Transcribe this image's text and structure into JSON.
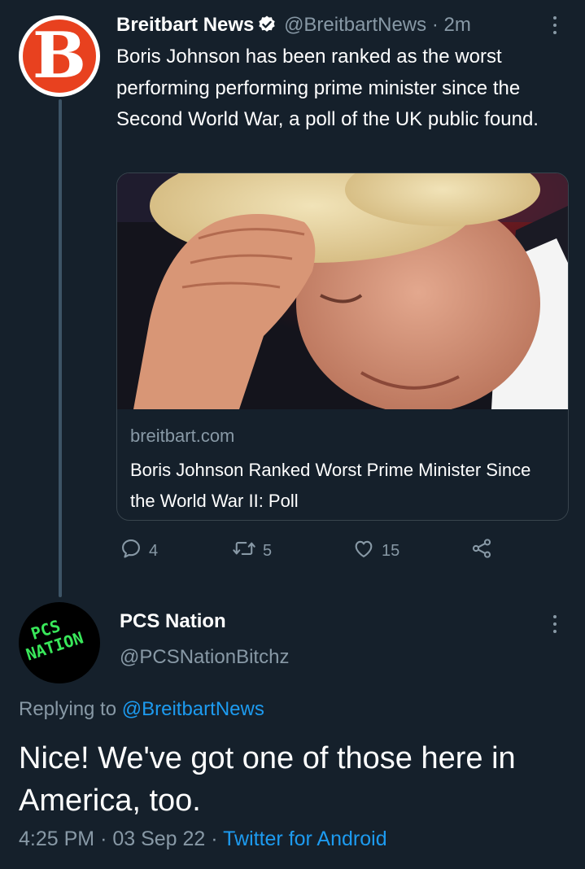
{
  "tweet": {
    "author_name": "Breitbart News",
    "handle": "@BreitbartNews",
    "separator": "·",
    "time": "2m",
    "avatar_letter": "B",
    "text": "Boris Johnson has been ranked as the worst performing performing prime minister since the Second World War, a poll of the UK public found.",
    "card": {
      "domain": "breitbart.com",
      "title": "Boris Johnson Ranked Worst Prime Minister Since the World War II: Poll"
    },
    "actions": {
      "replies": "4",
      "retweets": "5",
      "likes": "15"
    }
  },
  "reply": {
    "author_name": "PCS Nation",
    "handle": "@PCSNationBitchz",
    "avatar_text_1": "PCS",
    "avatar_text_2": "NATION",
    "replying_prefix": "Replying to",
    "replying_handle": "@BreitbartNews",
    "text": "Nice! We've got one of those here in America, too.",
    "time": "4:25 PM",
    "separator": "·",
    "date": "03 Sep 22",
    "source": "Twitter for Android"
  },
  "colors": {
    "background": "#15202b",
    "text": "#ffffff",
    "muted": "#8899a6",
    "link": "#1d9bf0",
    "brand_red": "#e8411f",
    "pcs_green": "#39e85a"
  },
  "icons": [
    "verified-badge-icon",
    "more-icon",
    "reply-icon",
    "retweet-icon",
    "like-icon",
    "share-icon"
  ]
}
